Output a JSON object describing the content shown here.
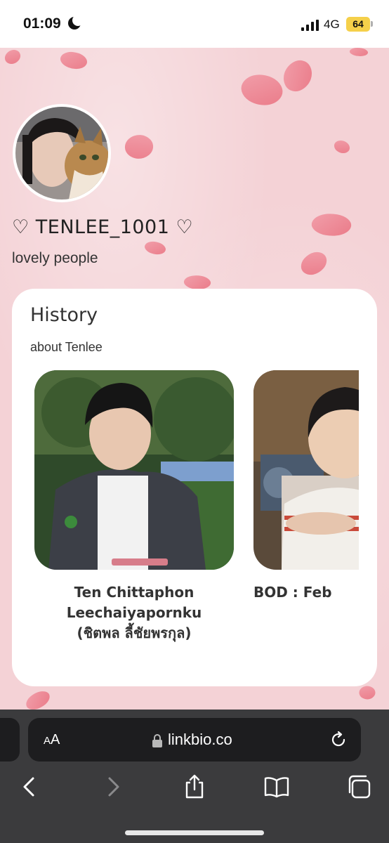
{
  "status_bar": {
    "time": "01:09",
    "network": "4G",
    "battery": "64"
  },
  "profile": {
    "name": "♡ TENLEE_1001 ♡",
    "bio": "lovely people"
  },
  "history": {
    "title": "History",
    "subtitle": "about Tenlee",
    "slides": [
      {
        "text": "Ten Chittaphon\nLeechaiyapornku\n(ชิตพล ลี้ชัยพรกุล)"
      },
      {
        "text": "BOD : Feb"
      }
    ]
  },
  "browser": {
    "text_size_label": "AA",
    "url": "linkbio.co"
  },
  "colors": {
    "accent": "#e9707f",
    "background": "#f4d2d6",
    "browser_bar": "#3b3b3d"
  }
}
